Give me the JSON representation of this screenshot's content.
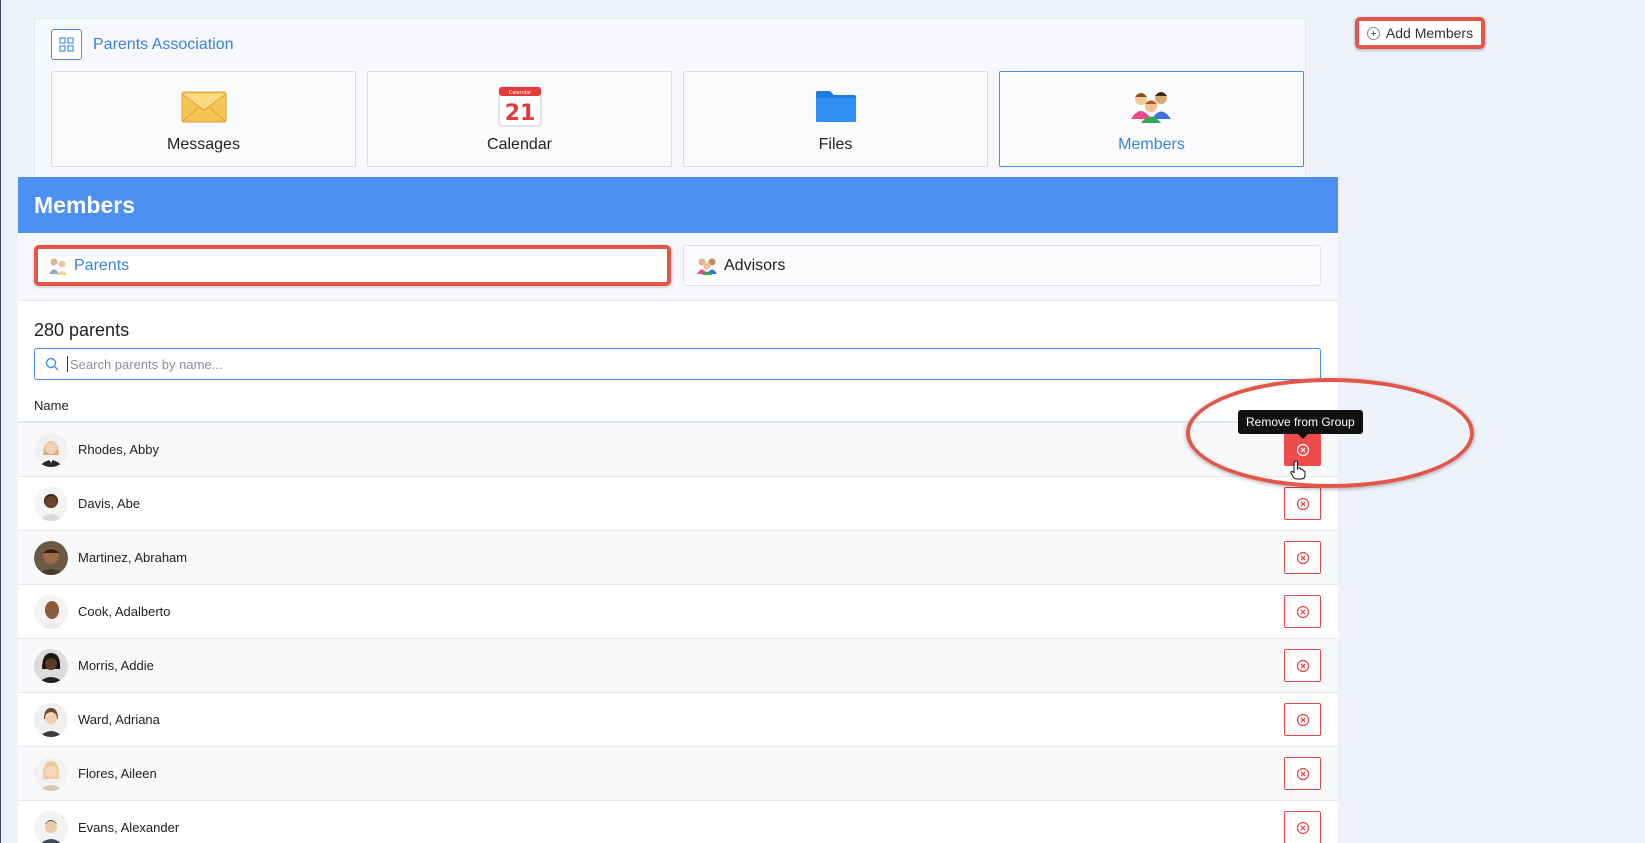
{
  "group": {
    "title": "Parents Association",
    "tiles": [
      {
        "label": "Messages",
        "icon": "envelope-icon"
      },
      {
        "label": "Calendar",
        "icon": "calendar-icon",
        "calendar_day": "21",
        "calendar_header": "Calendar"
      },
      {
        "label": "Files",
        "icon": "folder-icon"
      },
      {
        "label": "Members",
        "icon": "people-icon",
        "active": true
      }
    ]
  },
  "add_members_label": "Add Members",
  "members": {
    "header": "Members",
    "tabs": [
      {
        "label": "Parents",
        "active": true
      },
      {
        "label": "Advisors",
        "active": false
      }
    ],
    "count_label": "280 parents",
    "search_placeholder": "Search parents by name...",
    "column_name": "Name",
    "rows": [
      {
        "name": "Rhodes, Abby"
      },
      {
        "name": "Davis, Abe"
      },
      {
        "name": "Martinez, Abraham"
      },
      {
        "name": "Cook, Adalberto"
      },
      {
        "name": "Morris, Addie"
      },
      {
        "name": "Ward, Adriana"
      },
      {
        "name": "Flores, Aileen"
      },
      {
        "name": "Evans, Alexander"
      }
    ],
    "tooltip": "Remove from Group"
  },
  "colors": {
    "accent": "#4d90f4",
    "link": "#3b84d9",
    "danger": "#ef4b4b",
    "annotation": "#e4554a"
  }
}
